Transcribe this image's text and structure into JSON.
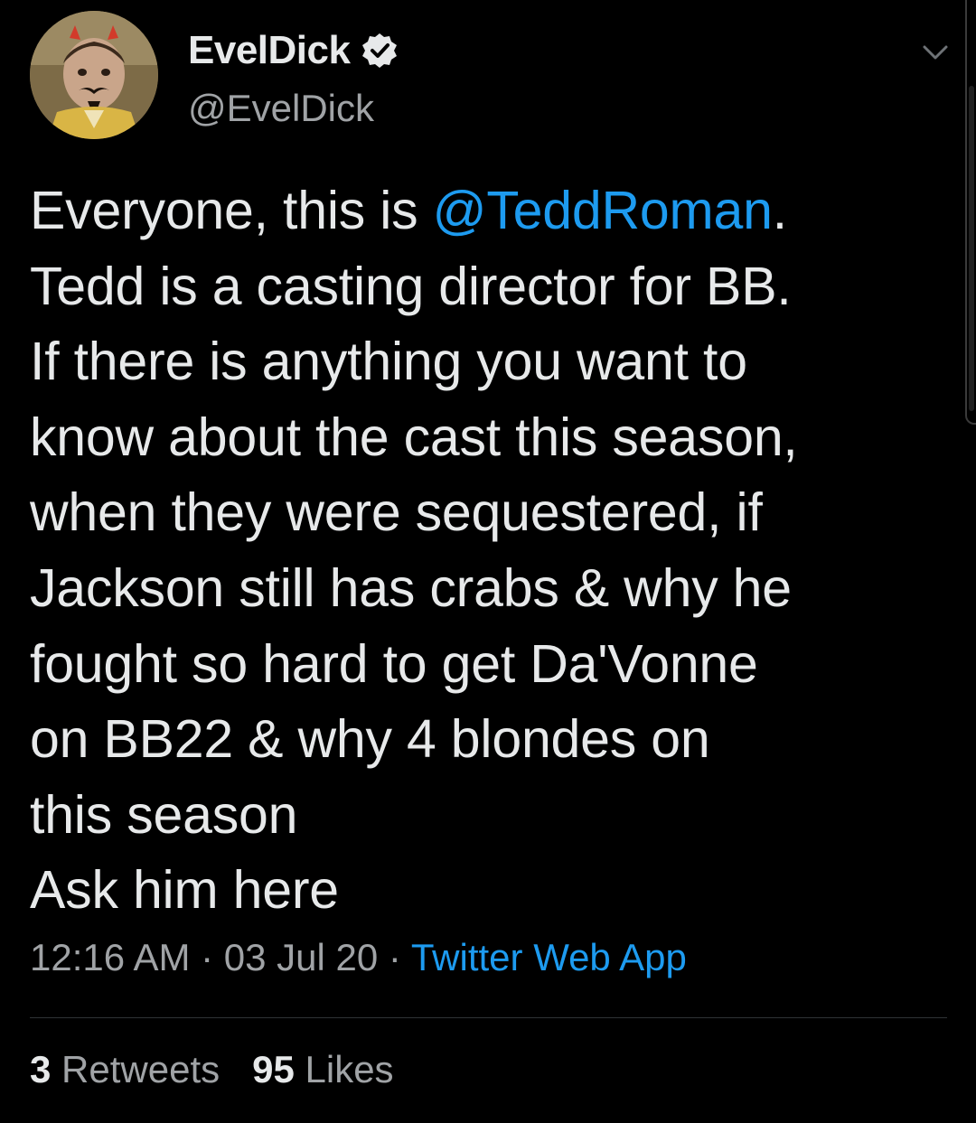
{
  "author": {
    "display_name": "EvelDick",
    "handle": "@EvelDick",
    "verified": true
  },
  "tweet": {
    "lines": [
      {
        "before": "Everyone, this is ",
        "mention": "@TeddRoman",
        "after": "."
      },
      {
        "text": "Tedd is a casting director for BB."
      },
      {
        "text": "If there is anything you want to"
      },
      {
        "text": "know about the cast this season,"
      },
      {
        "text": "when they were sequestered, if"
      },
      {
        "text": "Jackson still has crabs & why he"
      },
      {
        "text": "fought so hard to get Da'Vonne"
      },
      {
        "text": "on BB22 & why 4 blondes on"
      },
      {
        "text": "this season"
      },
      {
        "text": "Ask him here"
      }
    ]
  },
  "meta": {
    "time": "12:16 AM",
    "separator": " · ",
    "date": "03 Jul 20",
    "source": "Twitter Web App"
  },
  "stats": {
    "retweets_count": "3",
    "retweets_label": "Retweets",
    "likes_count": "95",
    "likes_label": "Likes"
  },
  "colors": {
    "background": "#000000",
    "text": "#e7e9ea",
    "secondary": "#a0a3a6",
    "accent": "#1d9bf0"
  },
  "icons": {
    "verified": "verified-badge-icon",
    "more": "chevron-down-icon"
  }
}
